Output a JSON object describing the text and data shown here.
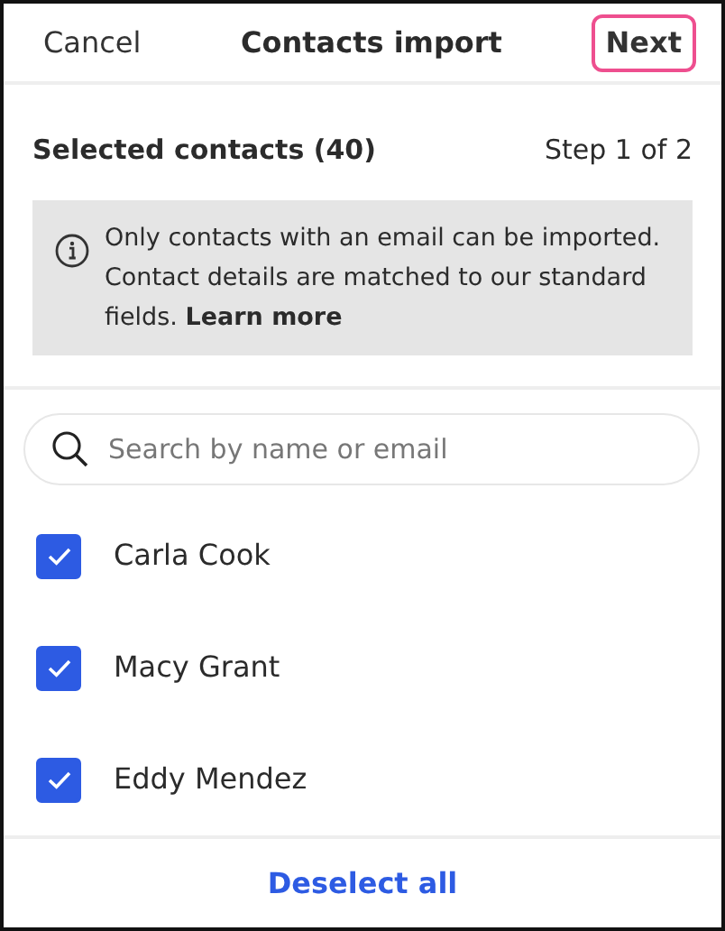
{
  "header": {
    "cancel": "Cancel",
    "title": "Contacts import",
    "next": {
      "label": "Next",
      "highlighted": true
    }
  },
  "summary": {
    "title": "Selected contacts (40)",
    "step": "Step 1 of 2"
  },
  "notice": {
    "text": "Only contacts with an email can be imported. Contact details are matched to our standard fields. **Learn more**"
  },
  "search": {
    "placeholder": "Search by name or email"
  },
  "contacts": [
    {
      "name": "Carla Cook",
      "checked": true
    },
    {
      "name": "Macy Grant",
      "checked": true
    },
    {
      "name": "Eddy Mendez",
      "checked": true
    }
  ],
  "footer": {
    "action": "Deselect all"
  }
}
